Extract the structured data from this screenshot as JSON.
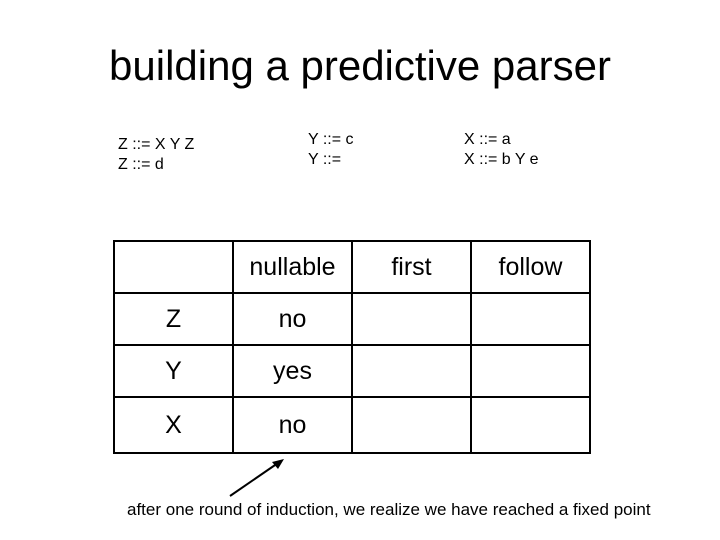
{
  "title": "building a predictive parser",
  "grammar": {
    "z_rules": [
      "Z ::= X Y Z",
      "Z ::= d"
    ],
    "y_rules": [
      "Y ::= c",
      "Y ::="
    ],
    "x_rules": [
      "X ::= a",
      "X ::= b Y e"
    ]
  },
  "table": {
    "headers": [
      "",
      "nullable",
      "first",
      "follow"
    ],
    "rows": [
      {
        "symbol": "Z",
        "nullable": "no",
        "first": "",
        "follow": ""
      },
      {
        "symbol": "Y",
        "nullable": "yes",
        "first": "",
        "follow": ""
      },
      {
        "symbol": "X",
        "nullable": "no",
        "first": "",
        "follow": ""
      }
    ]
  },
  "note": "after one round of induction, we realize we have reached a fixed point"
}
